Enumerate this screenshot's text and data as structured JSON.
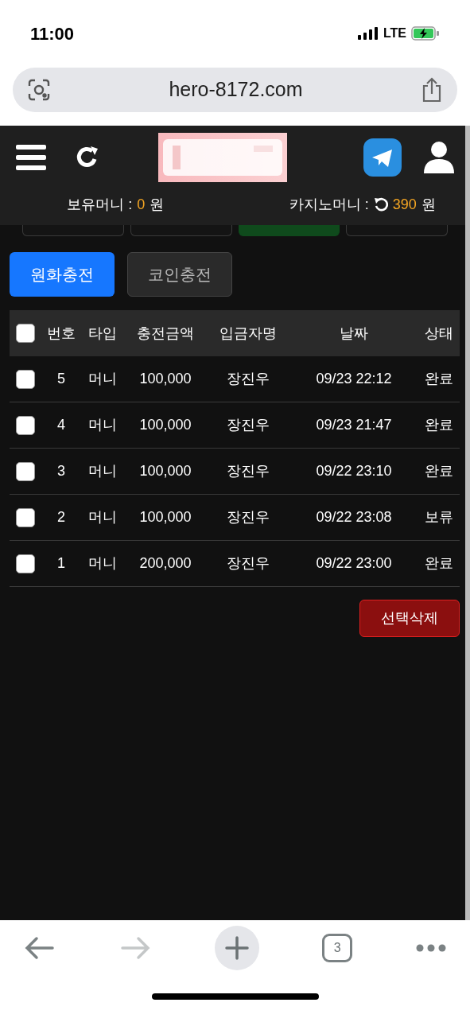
{
  "status_bar": {
    "time": "11:00",
    "network": "LTE"
  },
  "browser": {
    "url": "hero-8172.com",
    "tab_count": "3"
  },
  "balances": [
    {
      "label": "보유머니 :",
      "value": "0",
      "unit": "원",
      "refresh": false
    },
    {
      "label": "카지노머니 :",
      "value": "390",
      "unit": "원",
      "refresh": true
    }
  ],
  "menu_tabs": [
    {
      "selected": false
    },
    {
      "selected": false
    },
    {
      "selected": true
    },
    {
      "selected": false
    }
  ],
  "charge_tabs": [
    {
      "label": "원화충전",
      "selected": true
    },
    {
      "label": "코인충전",
      "selected": false
    }
  ],
  "table": {
    "all_checked": false,
    "columns": [
      "번호",
      "타입",
      "충전금액",
      "입금자명",
      "날짜",
      "상태"
    ],
    "rows": [
      {
        "checked": false,
        "cells": [
          "5",
          "머니",
          "100,000",
          "장진우",
          "09/23 22:12",
          "완료"
        ]
      },
      {
        "checked": false,
        "cells": [
          "4",
          "머니",
          "100,000",
          "장진우",
          "09/23 21:47",
          "완료"
        ]
      },
      {
        "checked": false,
        "cells": [
          "3",
          "머니",
          "100,000",
          "장진우",
          "09/22 23:10",
          "완료"
        ]
      },
      {
        "checked": false,
        "cells": [
          "2",
          "머니",
          "100,000",
          "장진우",
          "09/22 23:08",
          "보류"
        ]
      },
      {
        "checked": false,
        "cells": [
          "1",
          "머니",
          "200,000",
          "장진우",
          "09/22 23:00",
          "완료"
        ]
      }
    ]
  },
  "delete_button": "선택삭제"
}
